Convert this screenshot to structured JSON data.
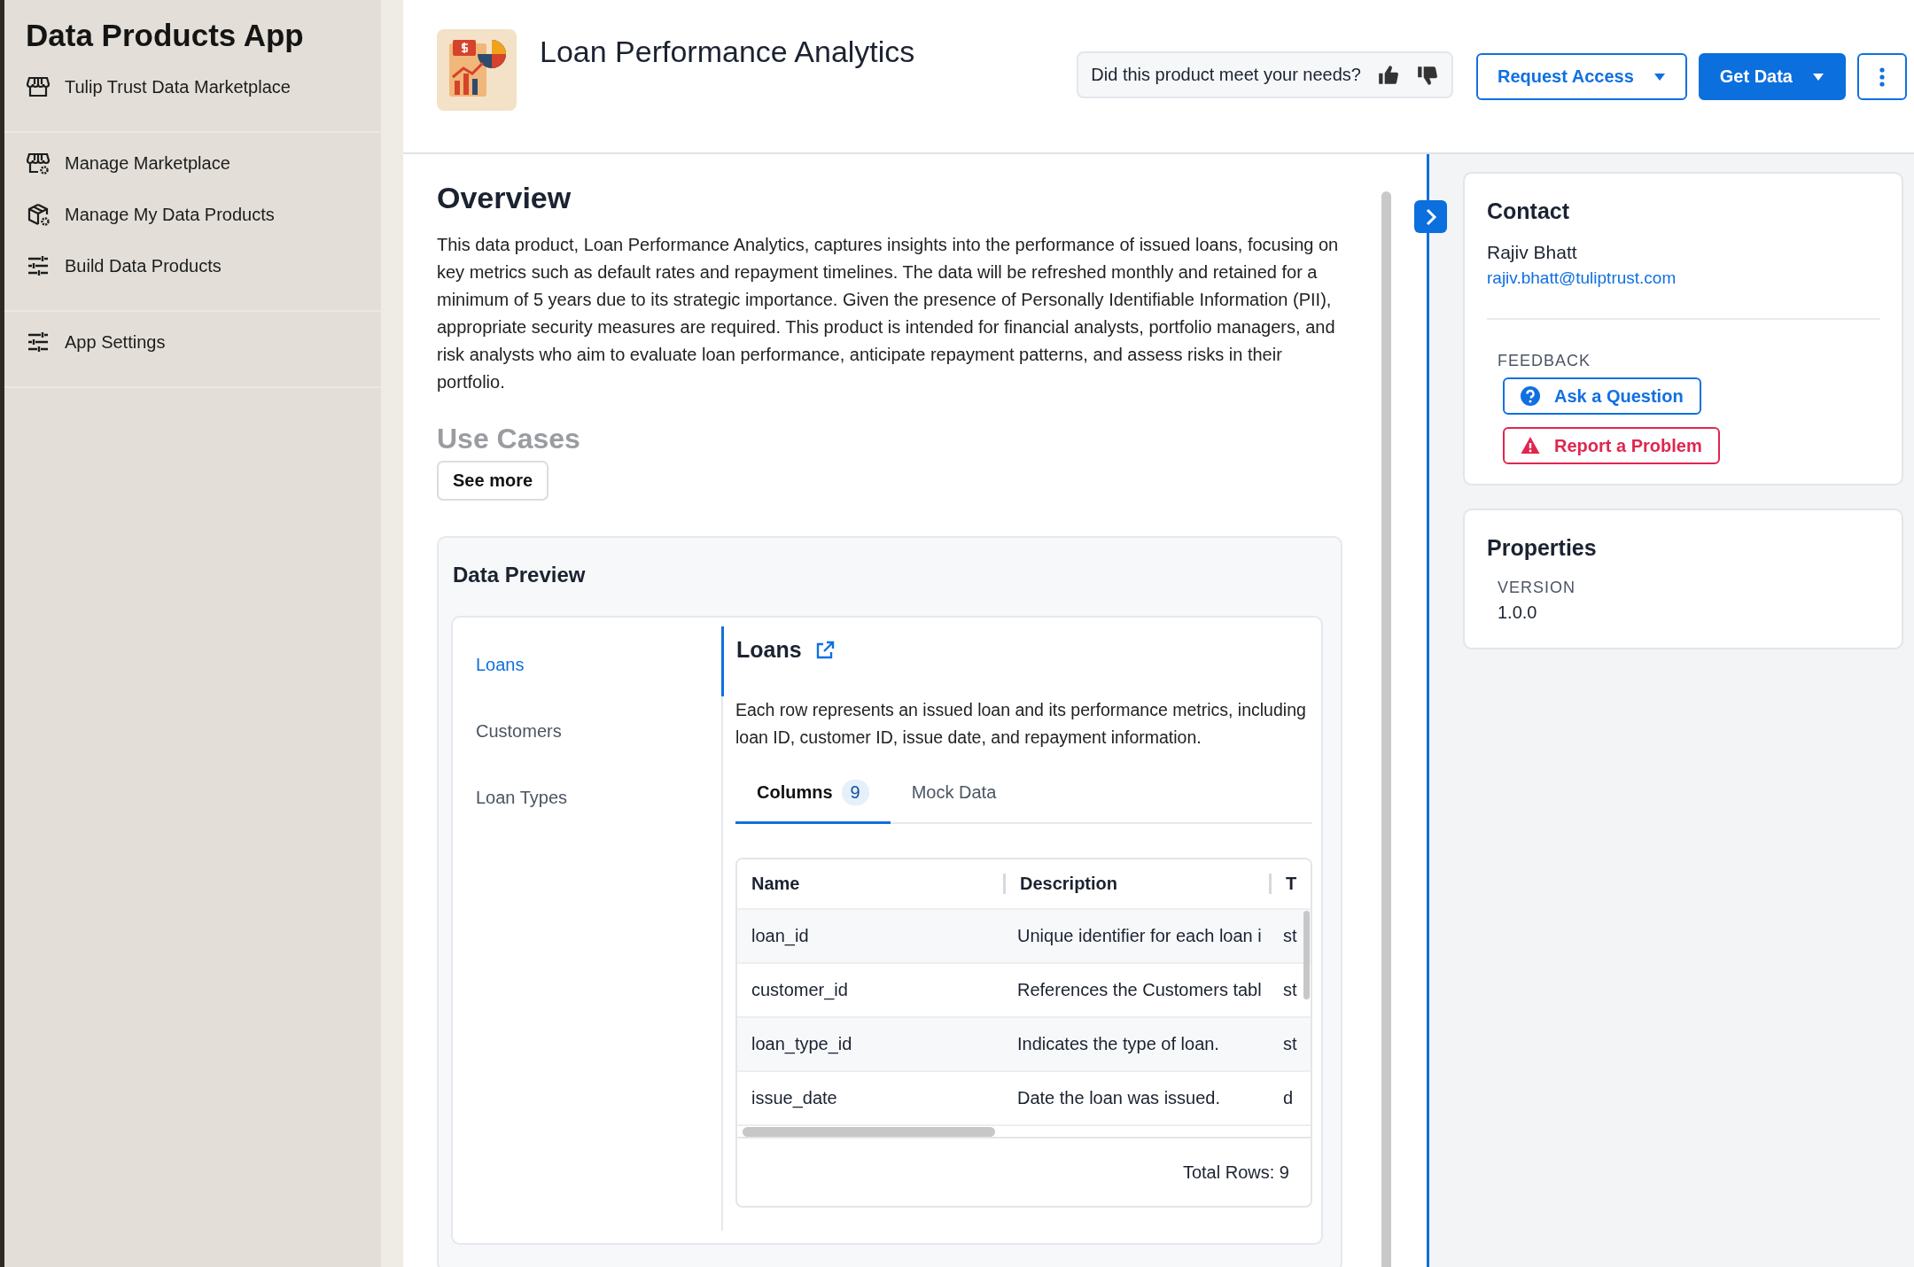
{
  "sidebar": {
    "title": "Data Products App",
    "sections": [
      [
        {
          "label": "Tulip Trust Data Marketplace",
          "kind": "store"
        }
      ],
      [
        {
          "label": "Manage Marketplace",
          "kind": "store-gear"
        },
        {
          "label": "Manage My Data Products",
          "kind": "box-gear"
        },
        {
          "label": "Build Data Products",
          "kind": "sliders"
        }
      ],
      [
        {
          "label": "App Settings",
          "kind": "sliders"
        }
      ]
    ]
  },
  "header": {
    "title": "Loan Performance Analytics",
    "feedback_prompt": "Did this product meet your needs?",
    "buttons": [
      {
        "label": "Request Access",
        "kind": "outline"
      },
      {
        "label": "Get Data",
        "kind": "primary"
      }
    ]
  },
  "overview": {
    "heading": "Overview",
    "text": "This data product, Loan Performance Analytics, captures insights into the performance of issued loans, focusing on key metrics such as default rates and repayment timelines. The data will be refreshed monthly and retained for a minimum of 5 years due to its strategic importance. Given the presence of Personally Identifiable Information (PII), appropriate security measures are required. This product is intended for financial analysts, portfolio managers, and risk analysts who aim to evaluate loan performance, anticipate repayment patterns, and assess risks in their portfolio.",
    "next_heading": "Use Cases",
    "see_more": "See more"
  },
  "data_preview": {
    "title": "Data Preview",
    "tables": [
      {
        "label": "Loans",
        "selected": true
      },
      {
        "label": "Customers",
        "selected": false
      },
      {
        "label": "Loan Types",
        "selected": false
      }
    ],
    "detail": {
      "title": "Loans",
      "description": "Each row represents an issued loan and its performance metrics, including loan ID, customer ID, issue date, and repayment information.",
      "tabs": [
        {
          "label": "Columns",
          "count": "9",
          "selected": true
        },
        {
          "label": "Mock Data",
          "selected": false
        }
      ],
      "columns": [
        "Name",
        "Description",
        "T"
      ],
      "rows": [
        [
          "loan_id",
          "Unique identifier for each loan i",
          "st"
        ],
        [
          "customer_id",
          "References the Customers tabl",
          "st"
        ],
        [
          "loan_type_id",
          "Indicates the type of loan.",
          "st"
        ],
        [
          "issue_date",
          "Date the loan was issued.",
          "d"
        ]
      ],
      "total": "Total Rows: 9"
    }
  },
  "contact": {
    "heading": "Contact",
    "name": "Rajiv Bhatt",
    "email": "rajiv.bhatt@tuliptrust.com",
    "feedback_label": "FEEDBACK",
    "buttons": [
      {
        "label": "Ask a Question",
        "kind": "question"
      },
      {
        "label": "Report a Problem",
        "kind": "problem"
      }
    ]
  },
  "properties": {
    "heading": "Properties",
    "items": [
      {
        "label": "VERSION",
        "value": "1.0.0"
      }
    ]
  }
}
